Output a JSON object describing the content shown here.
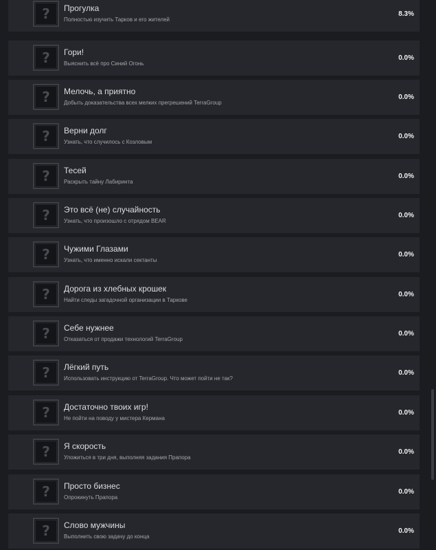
{
  "achievements": [
    {
      "title": "Прогулка",
      "desc": "Полностью изучить Тарков и его жителей",
      "percent": "8.3%",
      "icon": "question-mark-icon"
    },
    {
      "title": "Гори!",
      "desc": "Выяснить всё про Синий Огонь",
      "percent": "0.0%",
      "icon": "question-mark-icon"
    },
    {
      "title": "Мелочь, а приятно",
      "desc": "Добыть доказательства всех мелких прегрешений TerraGroup",
      "percent": "0.0%",
      "icon": "question-mark-icon"
    },
    {
      "title": "Верни долг",
      "desc": "Узнать, что случилось с Козловым",
      "percent": "0.0%",
      "icon": "question-mark-icon"
    },
    {
      "title": "Тесей",
      "desc": "Раскрыть тайну Лабиринта",
      "percent": "0.0%",
      "icon": "question-mark-icon"
    },
    {
      "title": "Это всё (не) случайность",
      "desc": "Узнать, что произошло с отрядом BEAR",
      "percent": "0.0%",
      "icon": "question-mark-icon"
    },
    {
      "title": "Чужими Глазами",
      "desc": "Узнать, что именно искали сектанты",
      "percent": "0.0%",
      "icon": "question-mark-icon"
    },
    {
      "title": "Дорога из хлебных крошек",
      "desc": "Найти следы загадочной организации в Таркове",
      "percent": "0.0%",
      "icon": "question-mark-icon"
    },
    {
      "title": "Себе нужнее",
      "desc": "Отказаться от продажи технологий TerraGroup",
      "percent": "0.0%",
      "icon": "question-mark-icon"
    },
    {
      "title": "Лёгкий путь",
      "desc": "Использовать инструкцию от TerraGroup. Что может пойти не так?",
      "percent": "0.0%",
      "icon": "question-mark-icon"
    },
    {
      "title": "Достаточно твоих игр!",
      "desc": "Не пойти на поводу у мистера Кермана",
      "percent": "0.0%",
      "icon": "question-mark-icon"
    },
    {
      "title": "Я скорость",
      "desc": "Уложиться в три дня, выполняя задания Прапора",
      "percent": "0.0%",
      "icon": "question-mark-icon"
    },
    {
      "title": "Просто бизнес",
      "desc": "Опрокинуть Прапора",
      "percent": "0.0%",
      "icon": "question-mark-icon"
    },
    {
      "title": "Слово мужчины",
      "desc": "Выполнить свою задачу до конца",
      "percent": "0.0%",
      "icon": "question-mark-icon"
    }
  ],
  "icon_glyph": "?",
  "colors": {
    "background": "#1b1c20",
    "row": "#26272d",
    "title": "#dcdedf",
    "description": "#a4a6a8",
    "percent": "#f2f2f2"
  }
}
